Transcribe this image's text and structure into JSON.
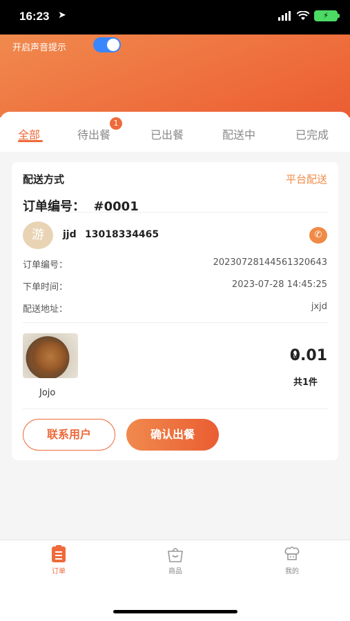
{
  "status_bar": {
    "time": "16:23"
  },
  "header": {
    "sound_label": "开启声音提示",
    "sound_enabled": true
  },
  "tabs": [
    {
      "label": "全部",
      "active": true
    },
    {
      "label": "待出餐",
      "badge": "1"
    },
    {
      "label": "已出餐"
    },
    {
      "label": "配送中"
    },
    {
      "label": "已完成"
    }
  ],
  "order": {
    "delivery_method_label": "配送方式",
    "delivery_method_value": "平台配送",
    "order_number_title": "订单编号：  #0001",
    "avatar_char": "游",
    "customer_name": "jjd",
    "customer_phone": "13018334465",
    "info": [
      {
        "label": "订单编号：",
        "value": "20230728144561320643"
      },
      {
        "label": "下单时间：",
        "value": "2023-07-28 14:45:25"
      },
      {
        "label": "配送地址：",
        "value": "jxjd"
      }
    ],
    "item_name": "Jojo",
    "currency_symbol": "¥",
    "price": "0.01",
    "quantity_text": "共1件",
    "contact_button": "联系用户",
    "confirm_button": "确认出餐"
  },
  "bottom_nav": [
    {
      "label": "订单",
      "icon": "order-icon",
      "active": true
    },
    {
      "label": "商品",
      "icon": "bag-icon"
    },
    {
      "label": "我的",
      "icon": "chef-icon"
    }
  ],
  "colors": {
    "accent": "#ee6a3a",
    "toggle": "#3a86ff"
  }
}
